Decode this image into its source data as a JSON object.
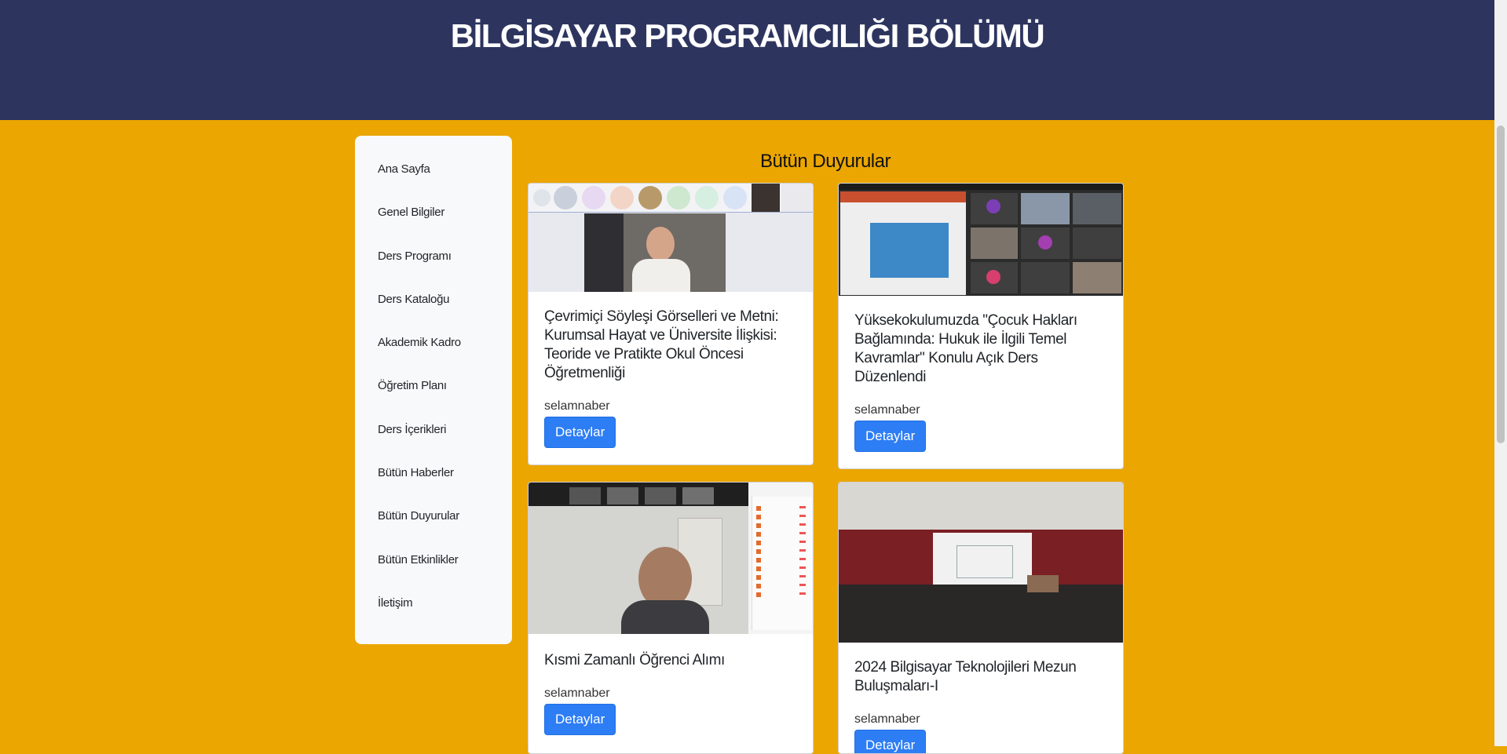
{
  "header": {
    "title": "BİLGİSAYAR PROGRAMCILIĞI BÖLÜMÜ"
  },
  "sidebar": {
    "items": [
      {
        "label": "Ana Sayfa"
      },
      {
        "label": "Genel Bilgiler"
      },
      {
        "label": "Ders Programı"
      },
      {
        "label": "Ders Kataloğu"
      },
      {
        "label": "Akademik Kadro"
      },
      {
        "label": "Öğretim Planı"
      },
      {
        "label": "Ders İçerikleri"
      },
      {
        "label": "Bütün Haberler"
      },
      {
        "label": "Bütün Duyurular"
      },
      {
        "label": "Bütün Etkinlikler"
      },
      {
        "label": "İletişim"
      }
    ]
  },
  "main": {
    "section_title": "Bütün Duyurular",
    "cards": [
      {
        "title": "Çevrimiçi Söyleşi Görselleri ve Metni: Kurumsal Hayat ve Üniversite İlişkisi: Teoride ve Pratikte Okul Öncesi Öğretmenliği",
        "author": "selamnaber",
        "button": "Detaylar"
      },
      {
        "title": "Yüksekokulumuzda \"Çocuk Hakları Bağlamında: Hukuk ile İlgili Temel Kavramlar\" Konulu Açık Ders Düzenlendi",
        "author": "selamnaber",
        "button": "Detaylar"
      },
      {
        "title": "Kısmi Zamanlı Öğrenci Alımı",
        "author": "selamnaber",
        "button": "Detaylar"
      },
      {
        "title": "2024 Bilgisayar Teknolojileri Mezun Buluşmaları-I",
        "author": "selamnaber",
        "button": "Detaylar"
      }
    ]
  },
  "colors": {
    "header_bg": "#2d355f",
    "page_bg": "#eba602",
    "button": "#2d7df4"
  }
}
